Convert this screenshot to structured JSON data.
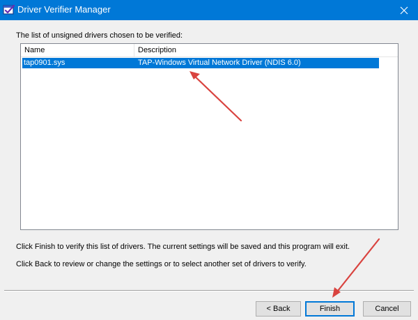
{
  "window": {
    "title": "Driver Verifier Manager",
    "titlebar_color": "#0078d7"
  },
  "icons": {
    "app": "driver-verifier-app-icon",
    "close": "close-icon"
  },
  "list": {
    "caption": "The list of unsigned drivers chosen to be verified:",
    "columns": [
      "Name",
      "Description"
    ],
    "rows": [
      {
        "name": "tap0901.sys",
        "description": "TAP-Windows Virtual Network Driver (NDIS 6.0)",
        "selected": true
      }
    ],
    "selection_color": "#0078d7"
  },
  "info": {
    "line1": "Click Finish to verify this list of drivers. The current settings will be saved and this program will exit.",
    "line2": "Click Back to review or change the settings or to select another set of drivers to verify."
  },
  "buttons": {
    "back": "< Back",
    "finish": "Finish",
    "cancel": "Cancel"
  },
  "annotation_color": "#d9433f"
}
